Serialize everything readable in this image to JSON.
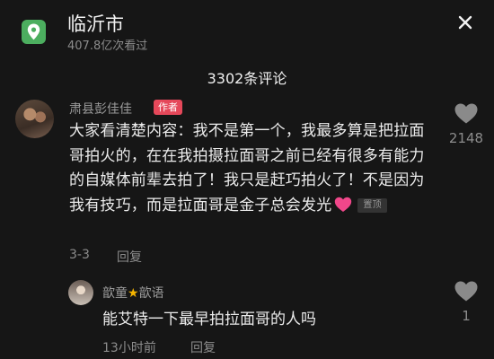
{
  "header": {
    "title": "临沂市",
    "views": "407.8亿次看过"
  },
  "comments_count": "3302条评论",
  "comment": {
    "author": "肃县彭佳佳",
    "badge": "作者",
    "text": "大家看清楚内容：我不是第一个，我最多算是把拉面哥拍火的，在在我拍摄拉面哥之前已经有很多有能力的自媒体前辈去拍了！我只是赶巧拍火了！不是因为我有技巧，而是拉面哥是金子总会发光",
    "pin_label": "置顶",
    "date": "3-3",
    "reply_label": "回复",
    "likes": "2148"
  },
  "reply": {
    "author_left": "歆童",
    "author_right": "歆语",
    "text": "能艾特一下最早拍拉面哥的人吗",
    "time": "13小时前",
    "reply_label": "回复",
    "likes": "1"
  },
  "colors": {
    "background": "#161616",
    "location_icon": "#4cae5f",
    "author_badge": "#e5485a",
    "heart_emoji": "#f0478a"
  },
  "icons": [
    "location-pin-icon",
    "close-icon",
    "heart-outline-icon",
    "heart-emoji-icon",
    "star-icon"
  ]
}
